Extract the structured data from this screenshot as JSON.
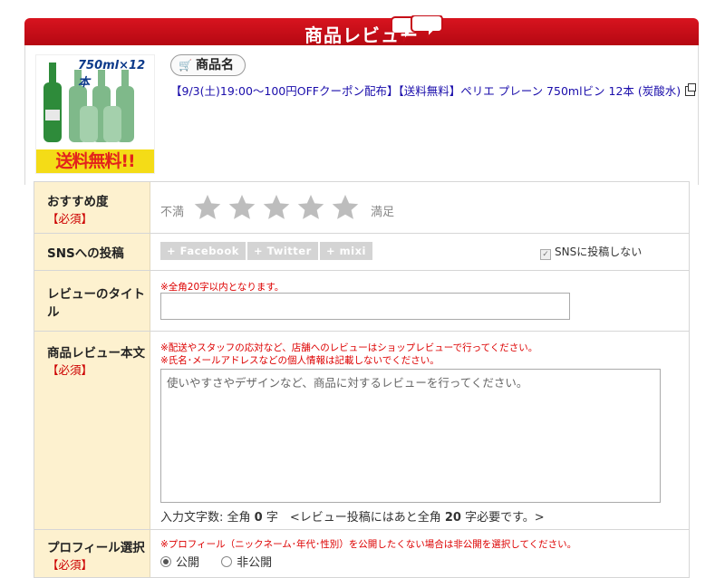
{
  "header": {
    "title": "商品レビュー"
  },
  "product": {
    "image_caption": "750ml×12本",
    "image_banner": "送料無料!!",
    "name_pill": "商品名",
    "link_text": "【9/3(土)19:00～100円OFFクーポン配布】【送料無料】ペリエ プレーン 750mlビン 12本 (炭酸水)"
  },
  "form": {
    "rating": {
      "label": "おすすめ度",
      "required": "【必須】",
      "low": "不満",
      "high": "満足",
      "stars": 5,
      "selected": 0,
      "star_color": "#bdbdbd"
    },
    "sns": {
      "label": "SNSへの投稿",
      "buttons": [
        "+ Facebook",
        "+ Twitter",
        "+ mixi"
      ],
      "checkbox_label": "SNSに投稿しない"
    },
    "title": {
      "label": "レビューのタイトル",
      "note": "※全角20字以内となります。",
      "value": ""
    },
    "body": {
      "label": "商品レビュー本文",
      "required": "【必須】",
      "note1": "※配送やスタッフの応対など、店舗へのレビューはショップレビューで行ってください。",
      "note2": "※氏名･メールアドレスなどの個人情報は記載しないでください。",
      "placeholder": "使いやすさやデザインなど、商品に対するレビューを行ってください。",
      "counter_prefix": "入力文字数: 全角 ",
      "counter_value": "0",
      "counter_mid": " 字　<レビュー投稿にはあと全角 ",
      "counter_remaining": "20",
      "counter_suffix": " 字必要です。>"
    },
    "profile": {
      "label": "プロフィール選択",
      "required": "【必須】",
      "note": "※プロフィール（ニックネーム･年代･性別）を公開したくない場合は非公開を選択してください。",
      "options": [
        "公開",
        "非公開"
      ],
      "selected": "公開"
    }
  },
  "colors": {
    "accent": "#c60d17",
    "label_bg": "#fdf1cf",
    "required": "#cc0000"
  }
}
